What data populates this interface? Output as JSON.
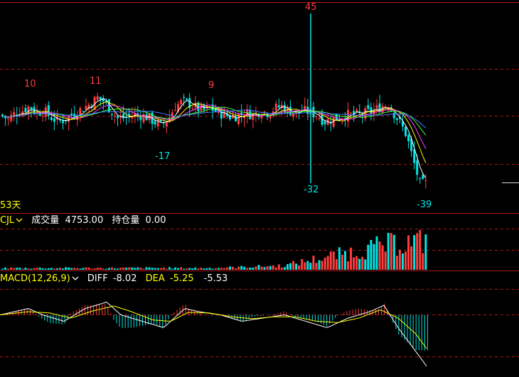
{
  "colors": {
    "up": "#ff3d3d",
    "down": "#00e5e5",
    "grid": "#b31616",
    "diff_line": "#ffffff",
    "dea_line": "#ffff00",
    "ma_lines": [
      "#ffffff",
      "#ffff00",
      "#ff40ff",
      "#40ff40",
      "#3f7fff"
    ],
    "panel_label": "#ffff00",
    "text": "#ffffff"
  },
  "price_panel": {
    "peak_markers": [
      "10",
      "11",
      "9",
      "45"
    ],
    "trough_markers": [
      "-17",
      "-32",
      "-39"
    ],
    "period_label": "53天"
  },
  "volume_panel": {
    "indicator": "CJL",
    "dropdown_icon": "chevron-down-icon",
    "volume_label": "成交量",
    "volume_value": "4753.00",
    "oi_label": "持仓量",
    "oi_value": "0.00"
  },
  "macd_panel": {
    "indicator": "MACD(12,26,9)",
    "dropdown_icon": "chevron-down-icon",
    "diff_label": "DIFF",
    "diff_value": "-8.02",
    "dea_label": "DEA",
    "dea_value": "-5.25",
    "macd_value": "-5.53"
  },
  "chart_data": [
    {
      "type": "candlestick",
      "title": "",
      "ylim": [
        -45,
        50
      ],
      "close_profile": [
        [
          0,
          -1
        ],
        [
          10,
          -3
        ],
        [
          20,
          0
        ],
        [
          30,
          1
        ],
        [
          40,
          3
        ],
        [
          50,
          0
        ],
        [
          60,
          1
        ],
        [
          70,
          -2
        ],
        [
          80,
          -4
        ],
        [
          90,
          -3
        ],
        [
          100,
          -1
        ],
        [
          110,
          1
        ],
        [
          120,
          3
        ],
        [
          130,
          5
        ],
        [
          135,
          7
        ],
        [
          145,
          5
        ],
        [
          155,
          1
        ],
        [
          165,
          -3
        ],
        [
          175,
          -2
        ],
        [
          185,
          -1
        ],
        [
          195,
          -1
        ],
        [
          205,
          -2
        ],
        [
          215,
          -4
        ],
        [
          225,
          -6
        ],
        [
          235,
          -3
        ],
        [
          245,
          3
        ],
        [
          255,
          5
        ],
        [
          265,
          4
        ],
        [
          275,
          2
        ],
        [
          285,
          1
        ],
        [
          295,
          2
        ],
        [
          305,
          0
        ],
        [
          315,
          -1
        ],
        [
          325,
          -2
        ],
        [
          335,
          -1
        ],
        [
          345,
          0
        ],
        [
          355,
          -1
        ],
        [
          365,
          1
        ],
        [
          375,
          0
        ],
        [
          385,
          2
        ],
        [
          395,
          3
        ],
        [
          405,
          1
        ],
        [
          415,
          0
        ],
        [
          425,
          1
        ],
        [
          435,
          0
        ],
        [
          445,
          -1
        ],
        [
          455,
          -4
        ],
        [
          465,
          -3
        ],
        [
          475,
          -2
        ],
        [
          485,
          -1
        ],
        [
          495,
          -1
        ],
        [
          505,
          -1
        ],
        [
          515,
          0
        ],
        [
          525,
          1
        ],
        [
          535,
          3
        ],
        [
          545,
          4
        ],
        [
          550,
          1
        ],
        [
          560,
          -4
        ],
        [
          570,
          -10
        ],
        [
          580,
          -22
        ],
        [
          590,
          -33
        ],
        [
          598,
          -32
        ]
      ]
    },
    {
      "type": "bar",
      "series": [
        {
          "name": "成交量",
          "values_profile": [
            [
              0,
              5
            ],
            [
              300,
              5
            ],
            [
              400,
              12
            ],
            [
              430,
              25
            ],
            [
              470,
              40
            ],
            [
              520,
              60
            ],
            [
              560,
              75
            ],
            [
              600,
              80
            ]
          ]
        }
      ]
    },
    {
      "type": "line",
      "series": [
        {
          "name": "DIFF",
          "values_profile": [
            [
              0,
              0
            ],
            [
              40,
              1
            ],
            [
              60,
              0
            ],
            [
              90,
              -1
            ],
            [
              120,
              1
            ],
            [
              150,
              2
            ],
            [
              170,
              0
            ],
            [
              200,
              -1
            ],
            [
              230,
              -2
            ],
            [
              260,
              1
            ],
            [
              280,
              0.5
            ],
            [
              310,
              0
            ],
            [
              340,
              -1
            ],
            [
              370,
              -0.5
            ],
            [
              400,
              0
            ],
            [
              430,
              -1
            ],
            [
              460,
              -2
            ],
            [
              490,
              -0.5
            ],
            [
              520,
              0.5
            ],
            [
              540,
              1.5
            ],
            [
              560,
              -2
            ],
            [
              580,
              -5
            ],
            [
              600,
              -8.02
            ]
          ]
        },
        {
          "name": "DEA",
          "values_profile": [
            [
              0,
              0
            ],
            [
              40,
              0.5
            ],
            [
              70,
              0.3
            ],
            [
              100,
              -0.5
            ],
            [
              130,
              0.6
            ],
            [
              160,
              1.4
            ],
            [
              185,
              0.5
            ],
            [
              215,
              -0.8
            ],
            [
              240,
              -1
            ],
            [
              265,
              0.4
            ],
            [
              295,
              0.3
            ],
            [
              325,
              -0.3
            ],
            [
              355,
              -0.6
            ],
            [
              385,
              -0.3
            ],
            [
              415,
              -0.3
            ],
            [
              445,
              -1
            ],
            [
              475,
              -1.2
            ],
            [
              505,
              -0.5
            ],
            [
              535,
              0.8
            ],
            [
              560,
              -0.5
            ],
            [
              585,
              -3
            ],
            [
              600,
              -5.25
            ]
          ]
        }
      ]
    }
  ]
}
